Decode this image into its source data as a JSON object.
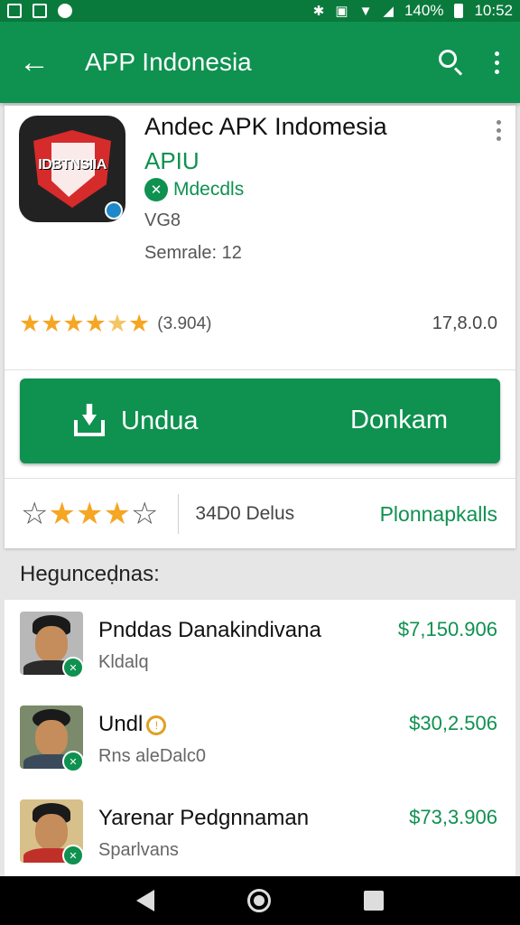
{
  "status_bar": {
    "battery": "140%",
    "time": "10:52"
  },
  "app_bar": {
    "title": "APP Indonesia"
  },
  "app": {
    "icon_text": "IDBTNSIIA",
    "name": "Andec APK Indomesia",
    "developer": "APIU",
    "verified_label": "Mdecdls",
    "age": "VG8",
    "size": "Semrale: 12",
    "rating_stars": 4.5,
    "rating_count": "(3.904)",
    "downloads": "17,8.0.0"
  },
  "install": {
    "label": "Undua",
    "secondary_label": "Donkam"
  },
  "review_bar": {
    "text": "34D0 Delus",
    "link": "Plonnapkalls"
  },
  "section": {
    "title": "Hegunceḍnas:"
  },
  "list_items": [
    {
      "name": "Pnddas Danakindivana",
      "sub": "Kldalq",
      "price": "$7,150.906",
      "shirt": "#2b2b2b"
    },
    {
      "name": "Undl",
      "sub": "Rns aleDalc0",
      "price": "$30,2.506",
      "shirt": "#3a4a5a"
    },
    {
      "name": "Yarenar Pedgnnaman",
      "sub": "Sparlvans",
      "price": "$73,3.906",
      "shirt": "#c0302a"
    }
  ],
  "colors": {
    "primary": "#0f9150",
    "status_bar": "#0a7a3c",
    "star": "#f5a623"
  }
}
